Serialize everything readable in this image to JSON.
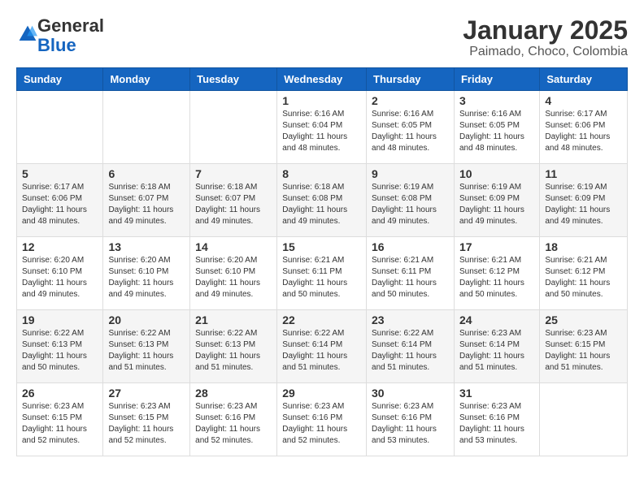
{
  "header": {
    "logo_general": "General",
    "logo_blue": "Blue",
    "month_title": "January 2025",
    "subtitle": "Paimado, Choco, Colombia"
  },
  "weekdays": [
    "Sunday",
    "Monday",
    "Tuesday",
    "Wednesday",
    "Thursday",
    "Friday",
    "Saturday"
  ],
  "weeks": [
    [
      {
        "day": "",
        "info": ""
      },
      {
        "day": "",
        "info": ""
      },
      {
        "day": "",
        "info": ""
      },
      {
        "day": "1",
        "info": "Sunrise: 6:16 AM\nSunset: 6:04 PM\nDaylight: 11 hours\nand 48 minutes."
      },
      {
        "day": "2",
        "info": "Sunrise: 6:16 AM\nSunset: 6:05 PM\nDaylight: 11 hours\nand 48 minutes."
      },
      {
        "day": "3",
        "info": "Sunrise: 6:16 AM\nSunset: 6:05 PM\nDaylight: 11 hours\nand 48 minutes."
      },
      {
        "day": "4",
        "info": "Sunrise: 6:17 AM\nSunset: 6:06 PM\nDaylight: 11 hours\nand 48 minutes."
      }
    ],
    [
      {
        "day": "5",
        "info": "Sunrise: 6:17 AM\nSunset: 6:06 PM\nDaylight: 11 hours\nand 48 minutes."
      },
      {
        "day": "6",
        "info": "Sunrise: 6:18 AM\nSunset: 6:07 PM\nDaylight: 11 hours\nand 49 minutes."
      },
      {
        "day": "7",
        "info": "Sunrise: 6:18 AM\nSunset: 6:07 PM\nDaylight: 11 hours\nand 49 minutes."
      },
      {
        "day": "8",
        "info": "Sunrise: 6:18 AM\nSunset: 6:08 PM\nDaylight: 11 hours\nand 49 minutes."
      },
      {
        "day": "9",
        "info": "Sunrise: 6:19 AM\nSunset: 6:08 PM\nDaylight: 11 hours\nand 49 minutes."
      },
      {
        "day": "10",
        "info": "Sunrise: 6:19 AM\nSunset: 6:09 PM\nDaylight: 11 hours\nand 49 minutes."
      },
      {
        "day": "11",
        "info": "Sunrise: 6:19 AM\nSunset: 6:09 PM\nDaylight: 11 hours\nand 49 minutes."
      }
    ],
    [
      {
        "day": "12",
        "info": "Sunrise: 6:20 AM\nSunset: 6:10 PM\nDaylight: 11 hours\nand 49 minutes."
      },
      {
        "day": "13",
        "info": "Sunrise: 6:20 AM\nSunset: 6:10 PM\nDaylight: 11 hours\nand 49 minutes."
      },
      {
        "day": "14",
        "info": "Sunrise: 6:20 AM\nSunset: 6:10 PM\nDaylight: 11 hours\nand 49 minutes."
      },
      {
        "day": "15",
        "info": "Sunrise: 6:21 AM\nSunset: 6:11 PM\nDaylight: 11 hours\nand 50 minutes."
      },
      {
        "day": "16",
        "info": "Sunrise: 6:21 AM\nSunset: 6:11 PM\nDaylight: 11 hours\nand 50 minutes."
      },
      {
        "day": "17",
        "info": "Sunrise: 6:21 AM\nSunset: 6:12 PM\nDaylight: 11 hours\nand 50 minutes."
      },
      {
        "day": "18",
        "info": "Sunrise: 6:21 AM\nSunset: 6:12 PM\nDaylight: 11 hours\nand 50 minutes."
      }
    ],
    [
      {
        "day": "19",
        "info": "Sunrise: 6:22 AM\nSunset: 6:13 PM\nDaylight: 11 hours\nand 50 minutes."
      },
      {
        "day": "20",
        "info": "Sunrise: 6:22 AM\nSunset: 6:13 PM\nDaylight: 11 hours\nand 51 minutes."
      },
      {
        "day": "21",
        "info": "Sunrise: 6:22 AM\nSunset: 6:13 PM\nDaylight: 11 hours\nand 51 minutes."
      },
      {
        "day": "22",
        "info": "Sunrise: 6:22 AM\nSunset: 6:14 PM\nDaylight: 11 hours\nand 51 minutes."
      },
      {
        "day": "23",
        "info": "Sunrise: 6:22 AM\nSunset: 6:14 PM\nDaylight: 11 hours\nand 51 minutes."
      },
      {
        "day": "24",
        "info": "Sunrise: 6:23 AM\nSunset: 6:14 PM\nDaylight: 11 hours\nand 51 minutes."
      },
      {
        "day": "25",
        "info": "Sunrise: 6:23 AM\nSunset: 6:15 PM\nDaylight: 11 hours\nand 51 minutes."
      }
    ],
    [
      {
        "day": "26",
        "info": "Sunrise: 6:23 AM\nSunset: 6:15 PM\nDaylight: 11 hours\nand 52 minutes."
      },
      {
        "day": "27",
        "info": "Sunrise: 6:23 AM\nSunset: 6:15 PM\nDaylight: 11 hours\nand 52 minutes."
      },
      {
        "day": "28",
        "info": "Sunrise: 6:23 AM\nSunset: 6:16 PM\nDaylight: 11 hours\nand 52 minutes."
      },
      {
        "day": "29",
        "info": "Sunrise: 6:23 AM\nSunset: 6:16 PM\nDaylight: 11 hours\nand 52 minutes."
      },
      {
        "day": "30",
        "info": "Sunrise: 6:23 AM\nSunset: 6:16 PM\nDaylight: 11 hours\nand 53 minutes."
      },
      {
        "day": "31",
        "info": "Sunrise: 6:23 AM\nSunset: 6:16 PM\nDaylight: 11 hours\nand 53 minutes."
      },
      {
        "day": "",
        "info": ""
      }
    ]
  ]
}
